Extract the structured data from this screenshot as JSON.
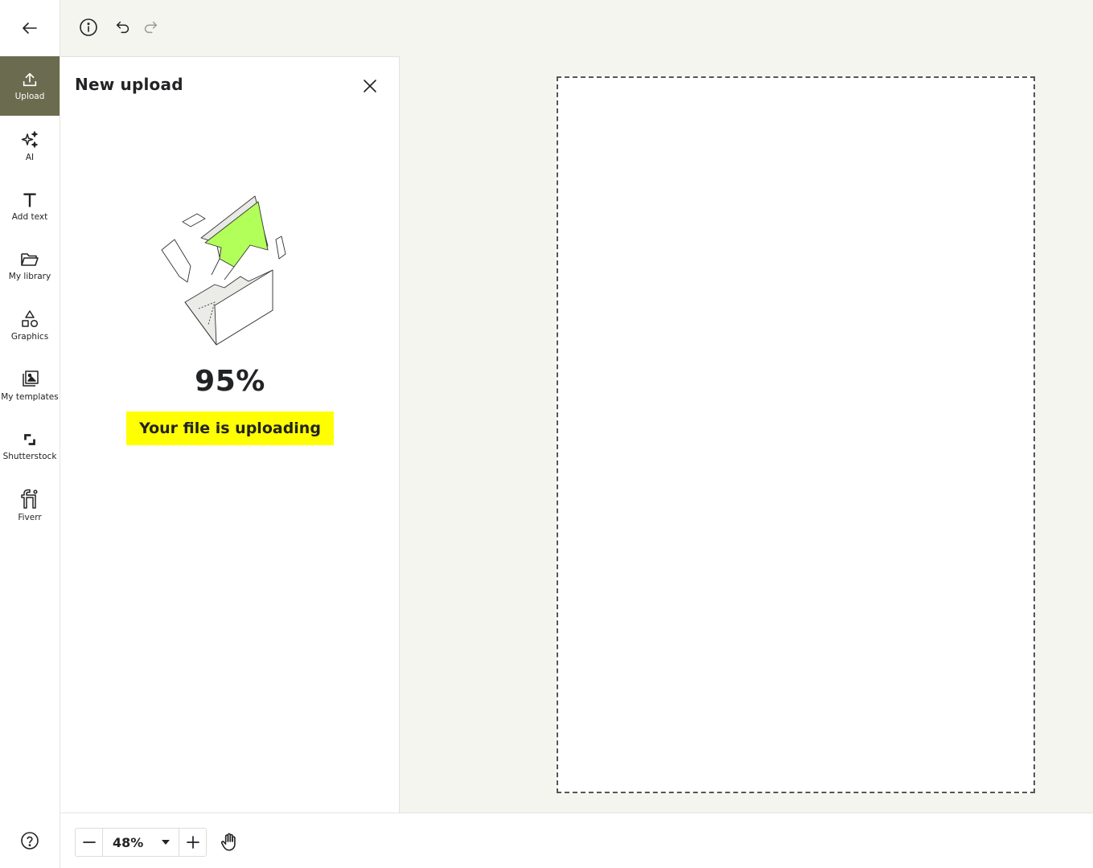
{
  "rail": {
    "items": [
      {
        "label": "Upload",
        "icon": "upload-icon",
        "active": true
      },
      {
        "label": "AI",
        "icon": "sparkles-icon"
      },
      {
        "label": "Add text",
        "icon": "text-icon"
      },
      {
        "label": "My library",
        "icon": "folder-icon"
      },
      {
        "label": "Graphics",
        "icon": "shapes-icon"
      },
      {
        "label": "My templates",
        "icon": "templates-icon"
      },
      {
        "label": "Shutterstock",
        "icon": "shutterstock-icon"
      },
      {
        "label": "Fiverr",
        "icon": "fiverr-icon"
      }
    ]
  },
  "panel": {
    "title": "New upload",
    "progress_text": "95%",
    "progress": 0.95,
    "status": "Your file is uploading"
  },
  "zoom": {
    "value": "48%"
  },
  "colors": {
    "active_rail": "#6b6b4f",
    "highlight": "#ffff00",
    "arrow_green": "#b2ff59",
    "text": "#222325",
    "canvas_bg": "#f5f5f0"
  }
}
